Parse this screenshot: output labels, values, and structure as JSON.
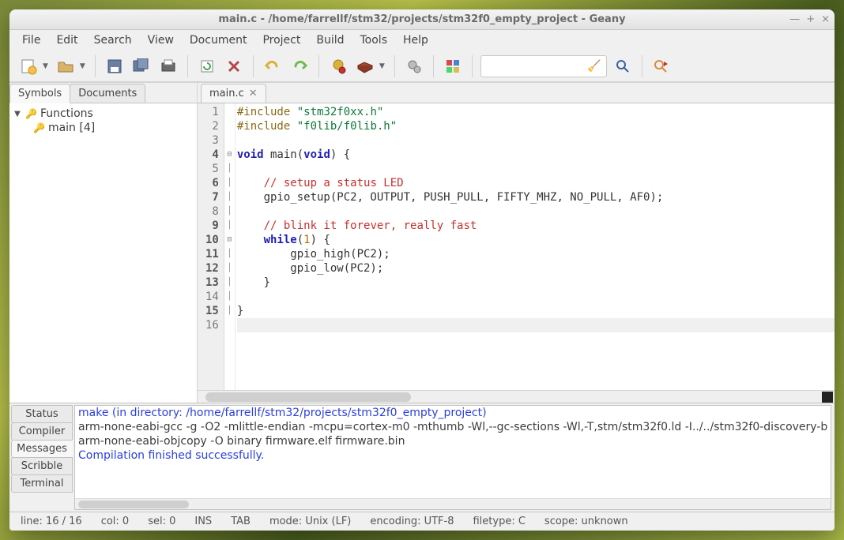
{
  "window": {
    "title": "main.c - /home/farrellf/stm32/projects/stm32f0_empty_project - Geany"
  },
  "menubar": [
    "File",
    "Edit",
    "Search",
    "View",
    "Document",
    "Project",
    "Build",
    "Tools",
    "Help"
  ],
  "sidepanel": {
    "tabs": {
      "symbols": "Symbols",
      "documents": "Documents"
    },
    "tree": {
      "functions_label": "Functions",
      "items": [
        {
          "label": "main [4]"
        }
      ]
    }
  },
  "editor": {
    "tab_name": "main.c",
    "lines": [
      {
        "n": "1",
        "bold": false,
        "fold": "",
        "html": "<span class='pp'>#include</span> <span class='str'>\"stm32f0xx.h\"</span>"
      },
      {
        "n": "2",
        "bold": false,
        "fold": "",
        "html": "<span class='pp'>#include</span> <span class='str'>\"f0lib/f0lib.h\"</span>"
      },
      {
        "n": "3",
        "bold": false,
        "fold": "",
        "html": ""
      },
      {
        "n": "4",
        "bold": true,
        "fold": "⊟",
        "html": "<span class='kw'>void</span> main(<span class='kw'>void</span>) {"
      },
      {
        "n": "5",
        "bold": false,
        "fold": "│",
        "html": ""
      },
      {
        "n": "6",
        "bold": true,
        "fold": "│",
        "html": "    <span class='cm'>// setup a status LED</span>"
      },
      {
        "n": "7",
        "bold": true,
        "fold": "│",
        "html": "    gpio_setup(PC2, OUTPUT, PUSH_PULL, FIFTY_MHZ, NO_PULL, AF0);"
      },
      {
        "n": "8",
        "bold": false,
        "fold": "│",
        "html": ""
      },
      {
        "n": "9",
        "bold": true,
        "fold": "│",
        "html": "    <span class='cm'>// blink it forever, really fast</span>"
      },
      {
        "n": "10",
        "bold": true,
        "fold": "⊟",
        "html": "    <span class='kw'>while</span>(<span class='num'>1</span>) {"
      },
      {
        "n": "11",
        "bold": true,
        "fold": "│",
        "html": "        gpio_high(PC2);"
      },
      {
        "n": "12",
        "bold": true,
        "fold": "│",
        "html": "        gpio_low(PC2);"
      },
      {
        "n": "13",
        "bold": true,
        "fold": "│",
        "html": "    }"
      },
      {
        "n": "14",
        "bold": false,
        "fold": "│",
        "html": ""
      },
      {
        "n": "15",
        "bold": true,
        "fold": "│",
        "html": "}"
      },
      {
        "n": "16",
        "bold": false,
        "fold": "",
        "html": "",
        "current": true
      }
    ]
  },
  "bottom": {
    "tabs": [
      "Status",
      "Compiler",
      "Messages",
      "Scribble",
      "Terminal"
    ],
    "active": 2,
    "messages": [
      {
        "text": "make (in directory: /home/farrellf/stm32/projects/stm32f0_empty_project)",
        "blue": true
      },
      {
        "text": "arm-none-eabi-gcc -g -O2 -mlittle-endian -mcpu=cortex-m0  -mthumb  -Wl,--gc-sections -Wl,-T,stm/stm32f0.ld -I../../stm32f0-discovery-b",
        "blue": false
      },
      {
        "text": "arm-none-eabi-objcopy -O binary firmware.elf firmware.bin",
        "blue": false
      },
      {
        "text": "Compilation finished successfully.",
        "blue": true
      }
    ]
  },
  "statusbar": {
    "line": "line: 16 / 16",
    "col": "col: 0",
    "sel": "sel: 0",
    "ins": "INS",
    "tab": "TAB",
    "mode": "mode: Unix (LF)",
    "encoding": "encoding: UTF-8",
    "filetype": "filetype: C",
    "scope": "scope: unknown"
  }
}
